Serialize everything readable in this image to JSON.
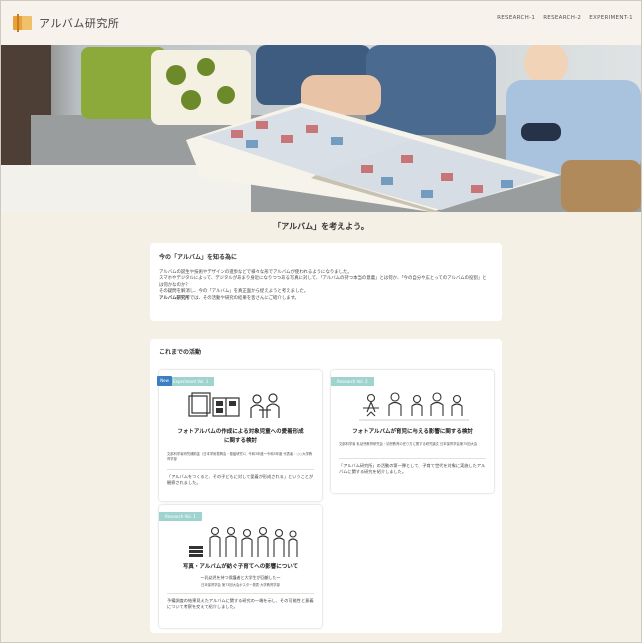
{
  "header": {
    "logo_text": "アルバム研究所",
    "nav": [
      "RESEARCH-1",
      "RESEARCH-2",
      "EXPERIMENT-1"
    ]
  },
  "tagline": "「アルバム」を考えよう。",
  "intro": {
    "heading": "今の「アルバム」を知る為に",
    "lines": [
      "アルバムの誕生や技術やデザインの進歩などで様々な形でアルバムが使われるようになりました。",
      "スマホやデジタルによって、デジタルがあまり身近になりつつある写真に対して、「アルバムの持つ本当の意義」とは何か、「今の自分や広とってのアルバムの役割」とは何かなのか？",
      "その疑問を解消し、今の「アルバム」を真正面から捉えようと考えました。"
    ],
    "strong": "アルバム研究所",
    "last_line": "では、その活動や研究の結果を皆さんにご紹介します。"
  },
  "activities": {
    "heading": "これまでの活動",
    "cards": [
      {
        "badge": "New",
        "tag": "Experiment Vol. 1",
        "title_l1": "フォトアルバムの作成による対象児童への愛着形成",
        "title_l2": "に関する検討",
        "meta": "文部科学省研究補助金（日本学術振興会・基盤研究C）令和3年度〜令和5年度 代表者：○○大学教育学部",
        "desc": "「アルバムをつくると、その子どもに対して愛着が形成される」ということが観察されました。"
      },
      {
        "tag": "Research Vol. 2",
        "title_l1": "フォトアルバムが育児に与える影響に関する検討",
        "meta": "文部科学省 乳幼児教育研究会・幼児教育の在り方に関する研究論文 日本保育学会第75回大会",
        "desc": "「アルバム研究所」の活動の第一弾として、子育て世代を対象に実施したアルバムに関する研究を紹介しました。"
      },
      {
        "tag": "Research Vol. 1",
        "title_l1": "写真・アルバムが紡ぐ子育てへの影響について",
        "sub": "〜乳幼児を持つ保護者と大学生が回顧した〜",
        "meta": "日本保育学会 第73回大会ポスター発表 大学教育学部",
        "desc": "予備調査の結果見えたアルバムに関する研究の一端を示し、その可能性と意義について考察を交えて紹介しました。"
      }
    ]
  }
}
